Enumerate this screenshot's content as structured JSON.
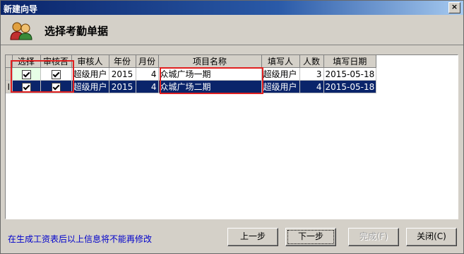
{
  "window": {
    "title": "新建向导",
    "close_label": "×"
  },
  "header": {
    "title": "选择考勤单据"
  },
  "grid": {
    "columns": [
      "选择",
      "审核否",
      "审核人",
      "年份",
      "月份",
      "项目名称",
      "填写人",
      "人数",
      "填写日期"
    ],
    "rows": [
      {
        "row_header": "",
        "selected": true,
        "approved": true,
        "approver": "超级用户",
        "year": "2015",
        "month": "4",
        "project": "众城广场一期",
        "filler": "超级用户",
        "count": "3",
        "date": "2015-05-18"
      },
      {
        "row_header": "I",
        "selected": true,
        "approved": true,
        "approver": "超级用户",
        "year": "2015",
        "month": "4",
        "project": "众城广场二期",
        "filler": "超级用户",
        "count": "4",
        "date": "2015-05-18"
      }
    ]
  },
  "footer": {
    "note": "在生成工资表后以上信息将不能再修改",
    "prev_label": "上一步",
    "next_label": "下一步",
    "finish_label": "完成(F)",
    "close_label": "关闭(C)"
  }
}
